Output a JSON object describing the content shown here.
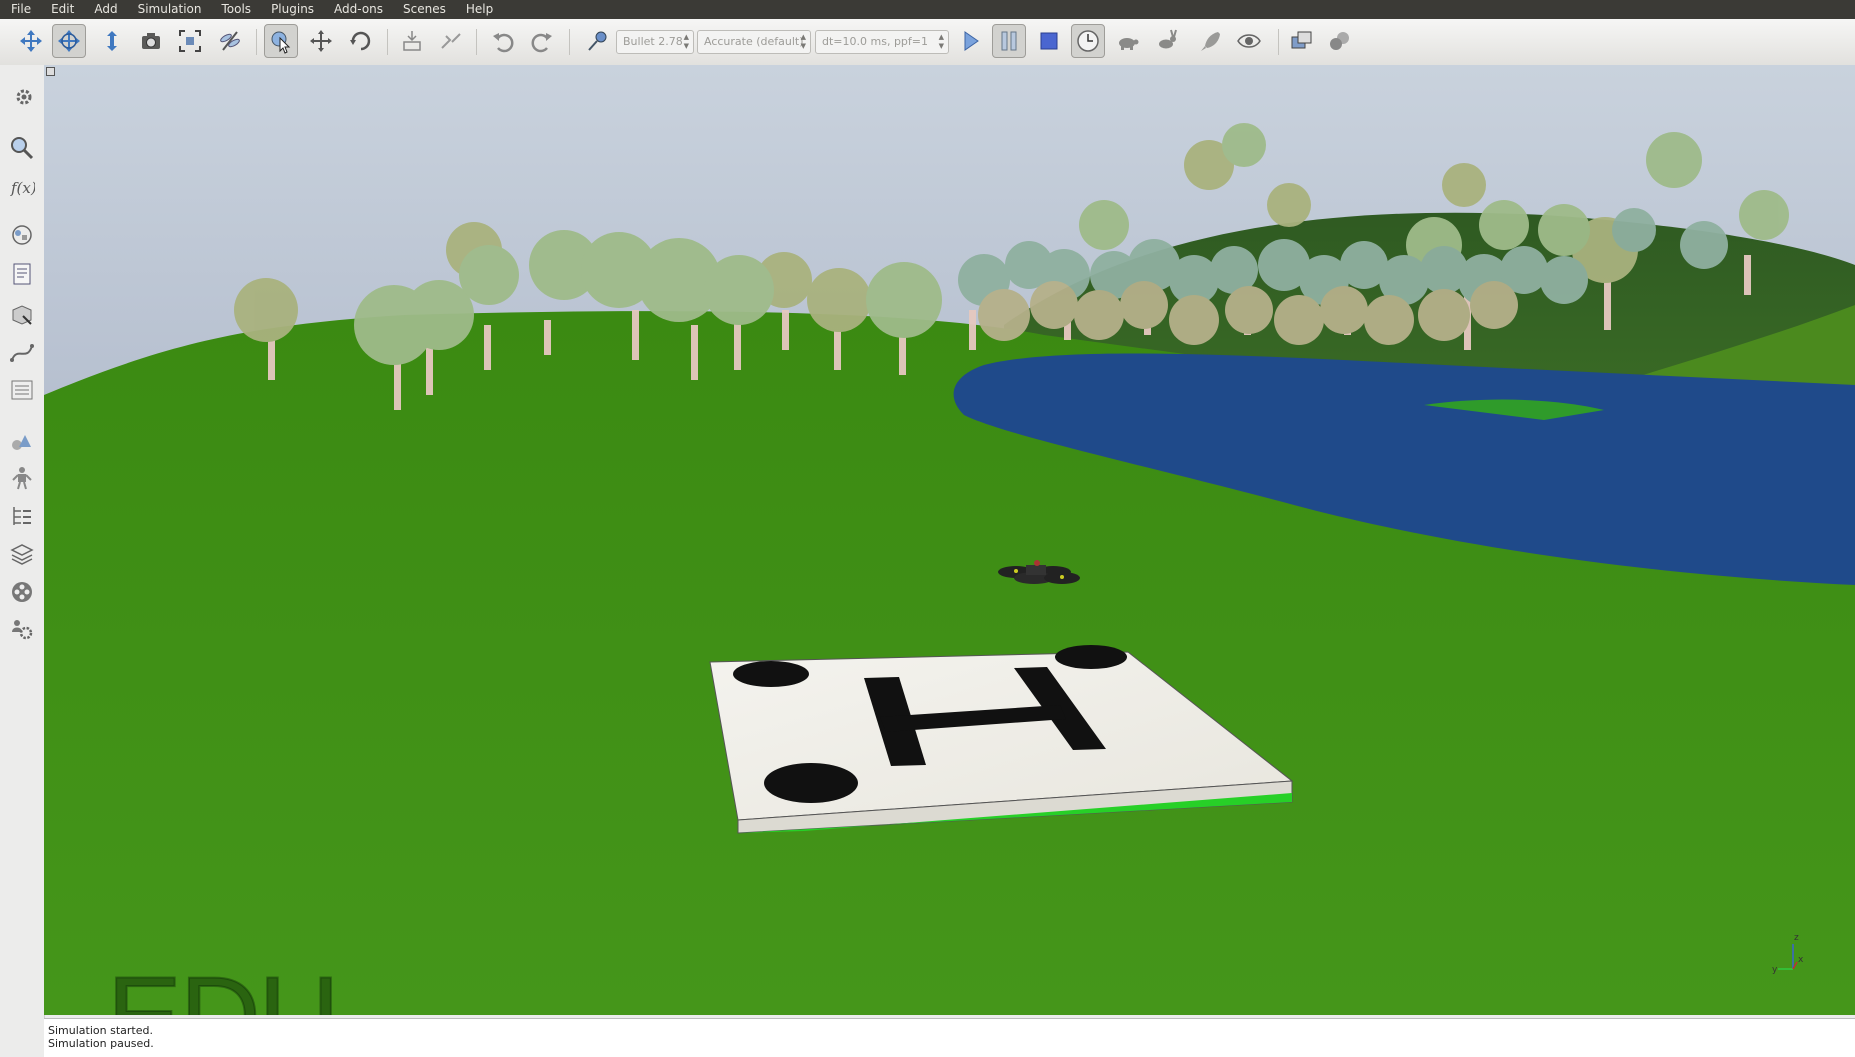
{
  "menubar": {
    "items": [
      "File",
      "Edit",
      "Add",
      "Simulation",
      "Tools",
      "Plugins",
      "Add-ons",
      "Scenes",
      "Help"
    ]
  },
  "toolbar": {
    "engine": "Bullet 2.78",
    "accuracy": "Accurate (default)",
    "timestep": "dt=10.0 ms, ppf=1"
  },
  "status": {
    "lines": [
      "Simulation started.",
      "Simulation paused."
    ]
  },
  "viewport": {
    "watermark": "EDU",
    "axis_x": "x",
    "axis_y": "y",
    "axis_z": "z"
  },
  "colors": {
    "grass": "#3f8f14",
    "water": "#1f4a8a",
    "sky_top": "#b9c4d3",
    "menubar": "#3b3a36"
  }
}
